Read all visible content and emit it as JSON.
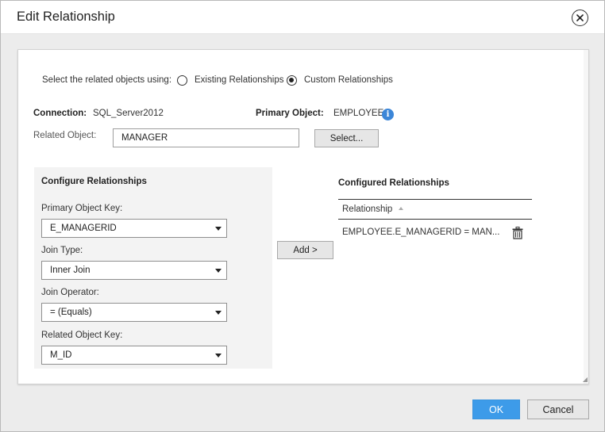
{
  "dialog": {
    "title": "Edit Relationship",
    "close_icon": "close-circle-icon"
  },
  "selection": {
    "label": "Select the related objects using:",
    "options": [
      {
        "label": "Existing Relationships",
        "selected": false
      },
      {
        "label": "Custom Relationships",
        "selected": true
      }
    ]
  },
  "connection": {
    "label": "Connection:",
    "value": "SQL_Server2012"
  },
  "primary_object": {
    "label": "Primary Object:",
    "value": "EMPLOYEE",
    "icon": "info-icon",
    "icon_glyph": "i",
    "icon_color": "#3b86d8"
  },
  "related_object": {
    "label": "Related Object:",
    "value": "MANAGER",
    "button_label": "Select..."
  },
  "configure": {
    "title": "Configure Relationships",
    "primary_key": {
      "label": "Primary Object Key:",
      "value": "E_MANAGERID"
    },
    "join_type": {
      "label": "Join Type:",
      "value": "Inner Join"
    },
    "join_operator": {
      "label": "Join Operator:",
      "value": "= (Equals)"
    },
    "related_key": {
      "label": "Related Object Key:",
      "value": "M_ID"
    }
  },
  "add_button": "Add >",
  "configured": {
    "title": "Configured Relationships",
    "column_header": "Relationship",
    "rows": [
      {
        "relationship": "EMPLOYEE.E_MANAGERID = MAN...",
        "delete_icon": "trash-icon"
      }
    ]
  },
  "footer": {
    "ok_label": "OK",
    "cancel_label": "Cancel"
  },
  "colors": {
    "accent": "#3d9be9",
    "info": "#3b86d8"
  }
}
